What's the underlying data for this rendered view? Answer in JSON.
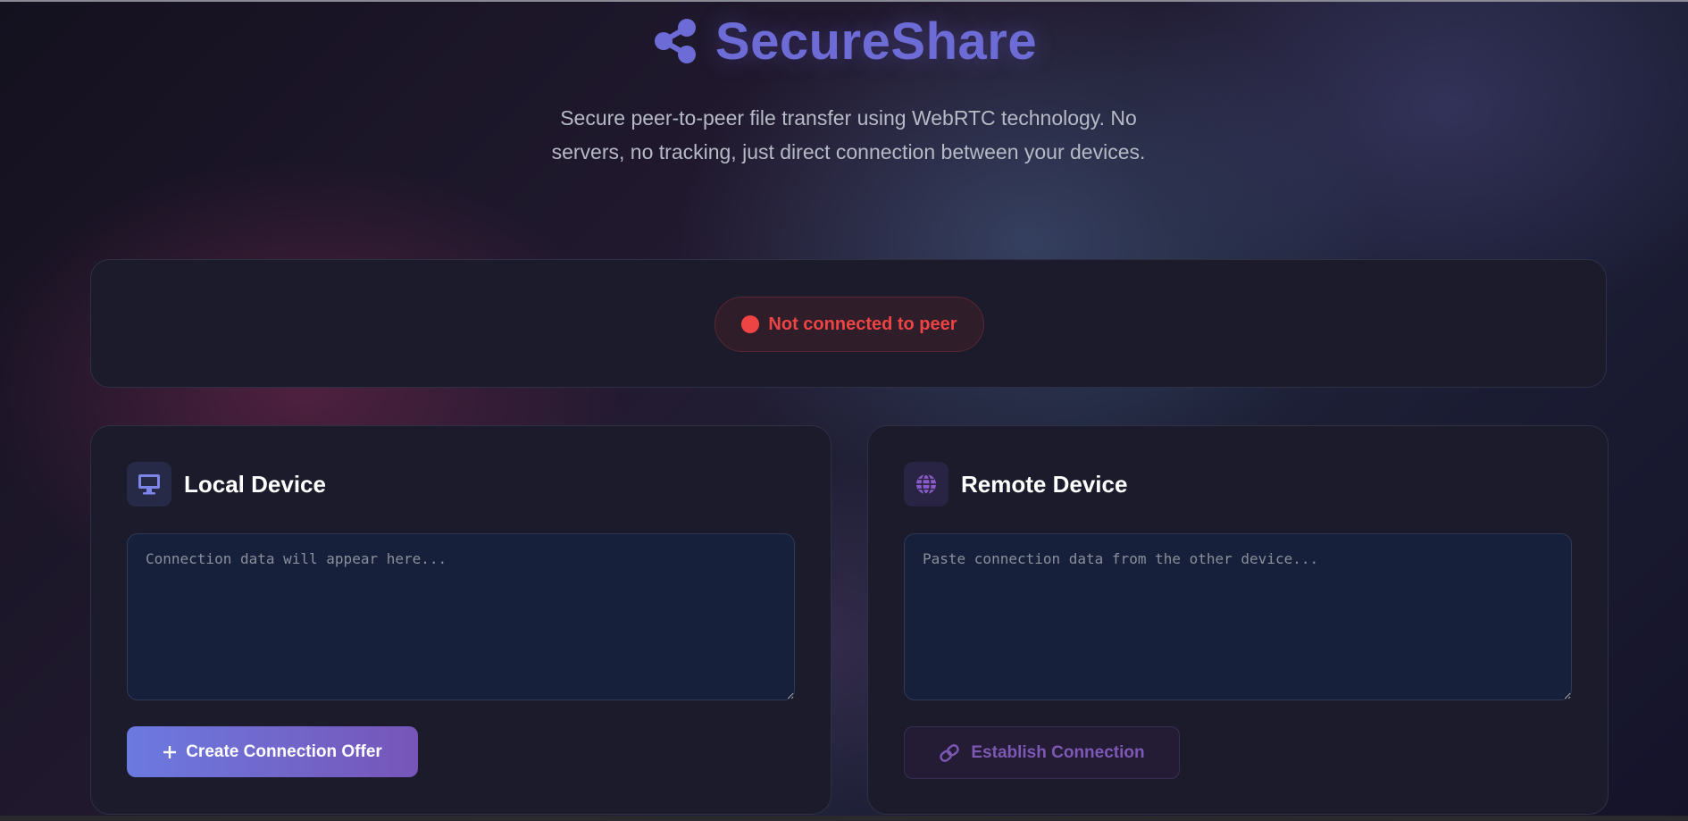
{
  "header": {
    "title": "SecureShare",
    "brand_icon": "share-icon",
    "subtitle": "Secure peer-to-peer file transfer using WebRTC technology. No servers, no tracking, just direct connection between your devices."
  },
  "status": {
    "text": "Not connected to peer",
    "color": "#ef4444"
  },
  "local": {
    "title": "Local Device",
    "icon": "monitor-icon",
    "value": "",
    "placeholder": "Connection data will appear here...",
    "button_label": "Create Connection Offer",
    "button_icon": "plus-icon"
  },
  "remote": {
    "title": "Remote Device",
    "icon": "globe-icon",
    "value": "",
    "placeholder": "Paste connection data from the other device...",
    "button_label": "Establish Connection",
    "button_icon": "link-icon"
  },
  "colors": {
    "accent": "#6d6bd6",
    "button_gradient_start": "#6b7ae0",
    "button_gradient_end": "#7755b8",
    "disabled_button_text": "#7e58b5",
    "panel_background": "#1b1b2b"
  }
}
